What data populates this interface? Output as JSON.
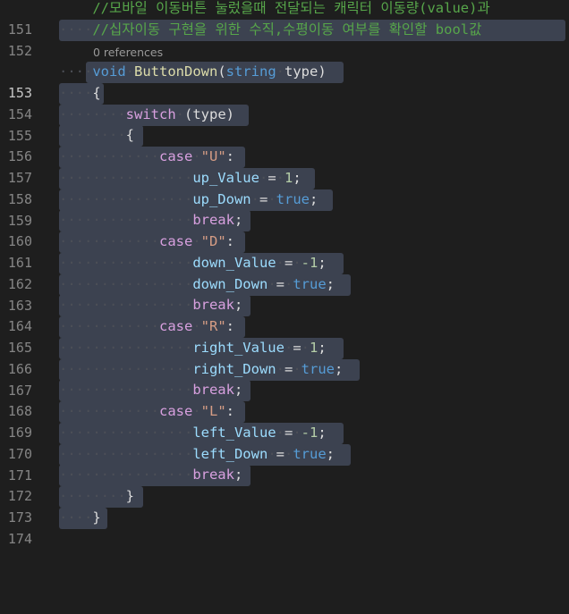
{
  "editor": {
    "line_numbers": [
      "151",
      "152",
      "153",
      "154",
      "155",
      "156",
      "157",
      "158",
      "159",
      "160",
      "161",
      "162",
      "163",
      "164",
      "165",
      "166",
      "167",
      "168",
      "169",
      "170",
      "171",
      "172",
      "173",
      "174"
    ],
    "codelens": "0 references",
    "comment1": "//모바일 이동버튼 눌렀을때 전달되는 캐릭터 이동량(value)과",
    "comment2": "//십자이동 구현을 위한 수직,수평이동 여부를 확인할 bool값",
    "method": {
      "kw_void": "void",
      "name": "ButtonDown",
      "open_paren": "(",
      "kw_string": "string",
      "param": "type",
      "close_paren": ")"
    },
    "brace_open": "{",
    "brace_close": "}",
    "switch_kw": "switch",
    "switch_arg": "(type)",
    "case_kw": "case",
    "break_stmt": "break",
    "semicolon": ";",
    "colon": ":",
    "assign": "=",
    "true_kw": "true",
    "cases": [
      {
        "label": "\"U\"",
        "value_var": "up_Value",
        "value": "1",
        "down_var": "up_Down"
      },
      {
        "label": "\"D\"",
        "value_var": "down_Value",
        "value": "-1",
        "down_var": "down_Down"
      },
      {
        "label": "\"R\"",
        "value_var": "right_Value",
        "value": "1",
        "down_var": "right_Down"
      },
      {
        "label": "\"L\"",
        "value_var": "left_Value",
        "value": "-1",
        "down_var": "left_Down"
      }
    ]
  }
}
